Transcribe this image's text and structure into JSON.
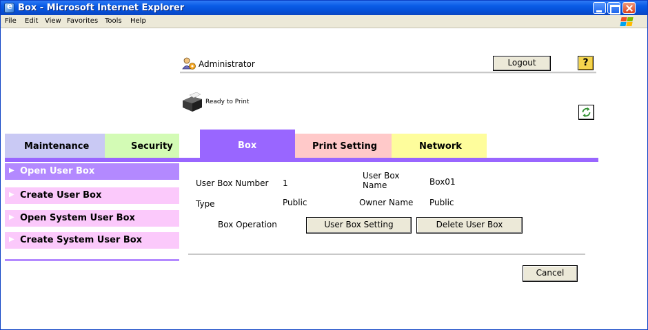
{
  "window": {
    "title": "Box - Microsoft Internet Explorer",
    "menu": [
      "File",
      "Edit",
      "View",
      "Favorites",
      "Tools",
      "Help"
    ]
  },
  "header": {
    "user": "Administrator",
    "logout_label": "Logout",
    "help_label": "?",
    "status": "Ready to Print"
  },
  "tabs": [
    {
      "label": "Maintenance",
      "color": "#c9c9f4"
    },
    {
      "label": "Security",
      "color": "#d3fbb5"
    },
    {
      "label": "Box",
      "color": "#9966ff",
      "active": true
    },
    {
      "label": "Print Setting",
      "color": "#ffc9c9"
    },
    {
      "label": "Network",
      "color": "#fefd9c"
    }
  ],
  "sidebar": {
    "items": [
      {
        "label": "Open User Box",
        "active": true
      },
      {
        "label": "Create User Box"
      },
      {
        "label": "Open System User Box"
      },
      {
        "label": "Create System User Box"
      }
    ]
  },
  "box_info": {
    "number_label": "User Box Number",
    "number_value": "1",
    "name_label_line1": "User Box",
    "name_label_line2": "Name",
    "name_value": "Box01",
    "type_label": "Type",
    "type_value": "Public",
    "owner_label": "Owner Name",
    "owner_value": "Public",
    "operation_label": "Box Operation",
    "setting_button": "User Box Setting",
    "delete_button": "Delete User Box"
  },
  "footer": {
    "cancel_label": "Cancel"
  }
}
